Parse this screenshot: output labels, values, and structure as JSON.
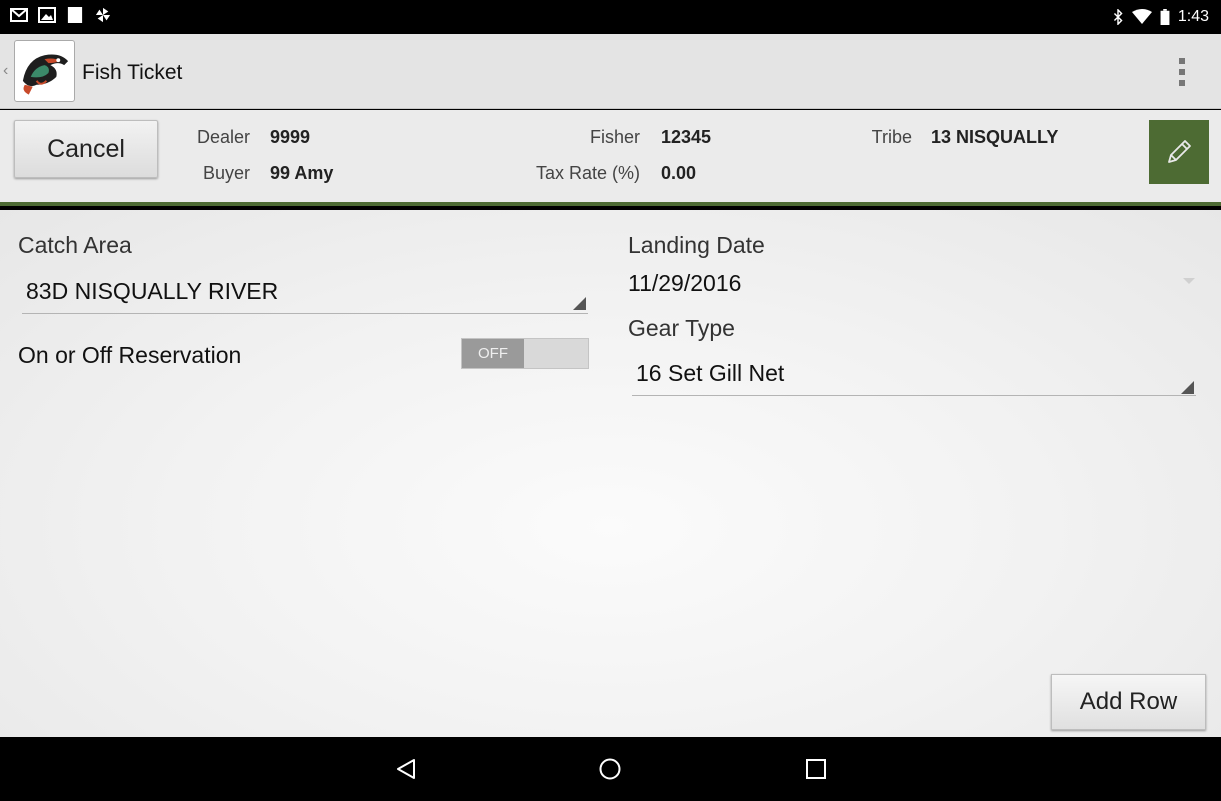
{
  "status_bar": {
    "left_icons": [
      "gmail-icon",
      "gallery-icon",
      "blank-notification-icon",
      "pinwheel-icon"
    ],
    "right_icons": [
      "bluetooth-icon",
      "wifi-icon",
      "battery-icon"
    ],
    "time": "1:43"
  },
  "action_bar": {
    "title": "Fish Ticket",
    "logo_icon": "orca-fish-logo-icon",
    "overflow_icon": "overflow-menu-icon"
  },
  "header": {
    "cancel_label": "Cancel",
    "dealer_label": "Dealer",
    "dealer_value": "9999",
    "buyer_label": "Buyer",
    "buyer_value": "99 Amy",
    "fisher_label": "Fisher",
    "fisher_value": "12345",
    "tax_rate_label": "Tax Rate (%)",
    "tax_rate_value": "0.00",
    "tribe_label": "Tribe",
    "tribe_value": "13 NISQUALLY",
    "edit_icon": "pencil-icon",
    "accent_color": "#4d6b33"
  },
  "form": {
    "catch_area_label": "Catch Area",
    "catch_area_value": "83D NISQUALLY RIVER",
    "reservation_label": "On or Off Reservation",
    "reservation_toggle": "OFF",
    "landing_date_label": "Landing Date",
    "landing_date_value": "11/29/2016",
    "gear_type_label": "Gear Type",
    "gear_type_value": "16 Set Gill Net"
  },
  "add_row_label": "Add Row",
  "nav_bar": {
    "back_icon": "back-triangle-icon",
    "home_icon": "home-circle-icon",
    "recents_icon": "recents-square-icon"
  }
}
